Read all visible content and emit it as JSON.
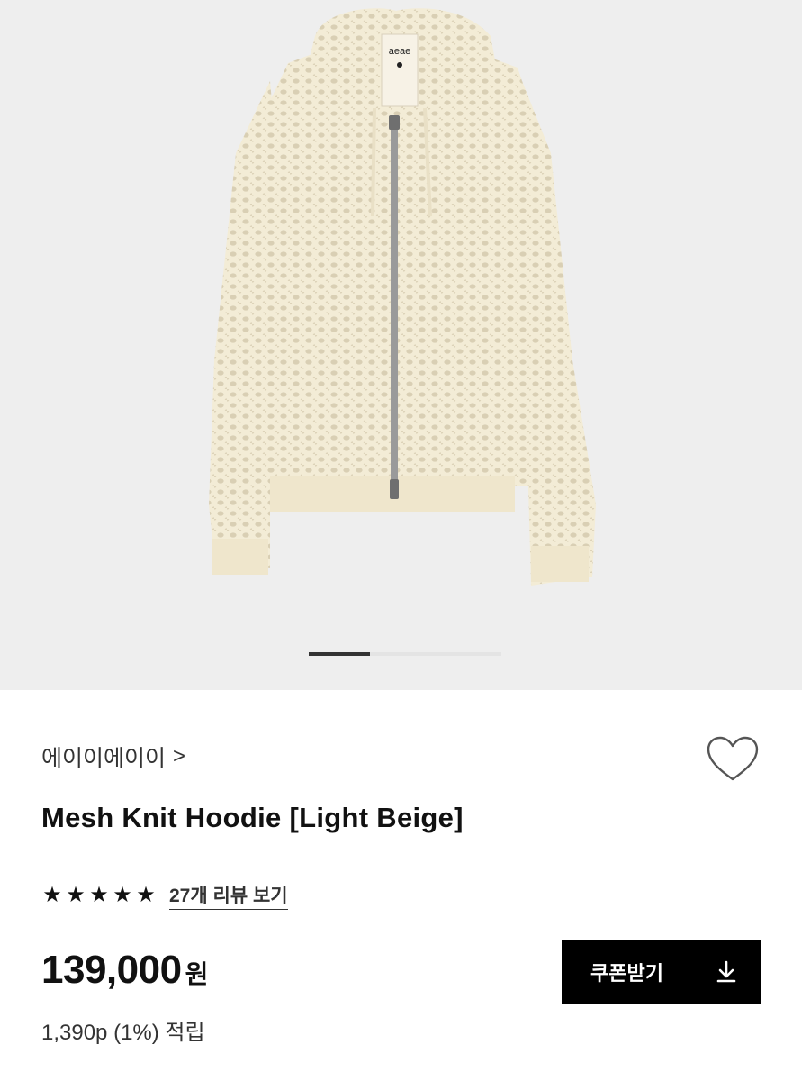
{
  "product_image": {
    "tag_text": "aeae",
    "pager": {
      "total_slides": 3,
      "active_index": 0
    }
  },
  "brand": {
    "name": "에이이에이이",
    "chevron": ">"
  },
  "wishlist": {
    "icon": "heart-outline-icon"
  },
  "product": {
    "title": "Mesh Knit Hoodie [Light Beige]"
  },
  "rating": {
    "stars": 5,
    "star_glyph": "★",
    "review_link": "27개 리뷰 보기"
  },
  "price": {
    "amount": "139,000",
    "unit": "원"
  },
  "points": {
    "text": "1,390p (1%) 적립"
  },
  "coupon_button": {
    "label": "쿠폰받기",
    "icon": "download-icon"
  },
  "colors": {
    "hero_background": "#eeeeee",
    "garment": "#f3ecd6",
    "button_background": "#000000",
    "text_primary": "#111111"
  }
}
